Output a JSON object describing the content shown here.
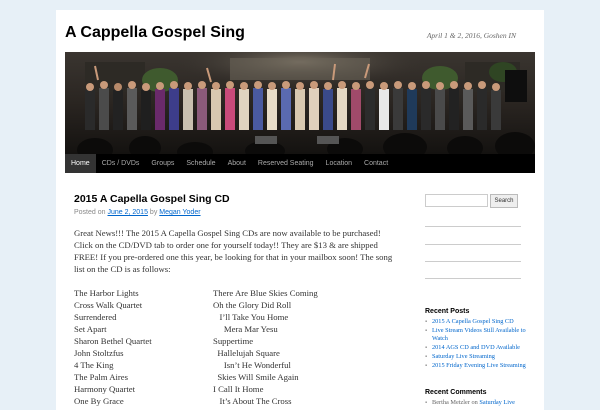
{
  "site": {
    "title": "A Cappella Gospel Sing",
    "description": "April 1 & 2, 2016, Goshen IN"
  },
  "nav": [
    "Home",
    "CDs / DVDs",
    "Groups",
    "Schedule",
    "About",
    "Reserved Seating",
    "Location",
    "Contact"
  ],
  "post": {
    "title": "2015 A Capella Gospel Sing CD",
    "meta_prefix": "Posted on",
    "date": "June 2, 2015",
    "meta_by": "by",
    "author": "Megan Yoder",
    "body": "Great News!!! The 2015 A Capella Gospel Sing CDs are now available to be purchased! Click on the CD/DVD tab to order one for yourself today!! They are $13 & are shipped FREE! If you pre-ordered one this year, be looking for that in your mailbox soon! The song list on the CD is as follows:",
    "songs_left": [
      "The Harbor Lights",
      "Cross Walk Quartet",
      "Surrendered",
      "Set Apart",
      "Sharon Bethel Quartet",
      "John Stoltzfus",
      "4 The King",
      "The Palm Aires",
      "Harmony Quartet",
      "One By Grace"
    ],
    "songs_right": [
      "There Are Blue Skies Coming",
      "Oh the Glory Did Roll",
      "   I’ll Take You Home",
      "     Mera Mar Yesu",
      "Suppertime",
      "  Hallelujah Square",
      "     Isn’t He Wonderful",
      "  Skies Will Smile Again",
      "I Call It Home",
      "   It’s About The Cross"
    ]
  },
  "sidebar": {
    "search_button": "Search",
    "recent_posts_title": "Recent Posts",
    "recent_posts": [
      "2015 A Capella Gospel Sing CD",
      "Live Stream Videos Still Available to Watch",
      "2014 AGS CD and DVD Available",
      "Saturday Live Streaming",
      "2015 Friday Evening Live Streaming"
    ],
    "recent_comments_title": "Recent Comments",
    "comment_author": "Bertha Metzler",
    "comment_on": "on",
    "comment_post": "Saturday Live"
  },
  "colors": {
    "link": "#0066cc",
    "nav_bg": "#000000",
    "page_bg": "#e7f0f7"
  }
}
